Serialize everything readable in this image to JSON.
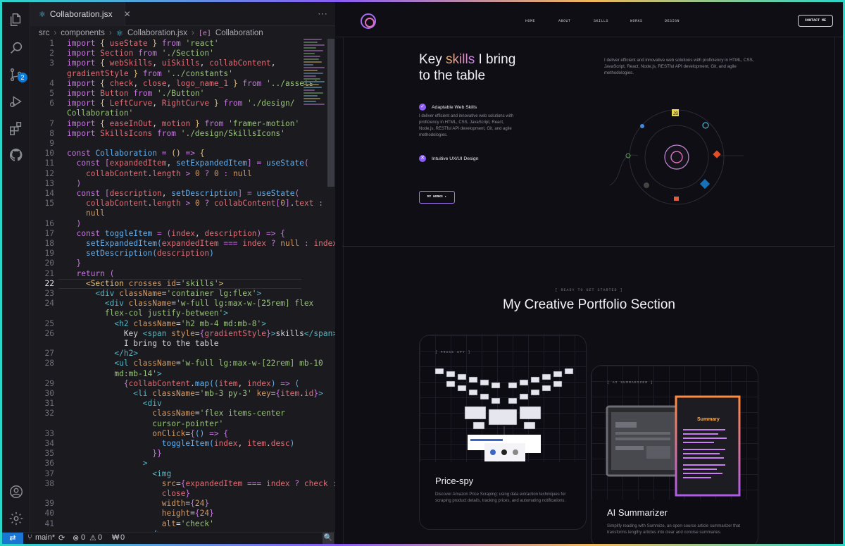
{
  "editor": {
    "tab_label": "Collaboration.jsx",
    "tab_close": "✕",
    "breadcrumb": {
      "folder1": "src",
      "folder2": "components",
      "file": "Collaboration.jsx",
      "symbol": "Collaboration"
    },
    "current_line": 22,
    "lines": [
      {
        "n": "1",
        "html": "<span class='k'>import</span> <span class='t'>{</span> <span class='r'>useState</span> <span class='t'>}</span> <span class='k'>from</span> <span class='s'>'react'</span>"
      },
      {
        "n": "2",
        "html": "<span class='k'>import</span> <span class='r'>Section</span> <span class='k'>from</span> <span class='s'>'./Section'</span>"
      },
      {
        "n": "3",
        "html": "<span class='k'>import</span> <span class='t'>{</span> <span class='r'>webSkills</span>, <span class='r'>uiSkills</span>, <span class='r'>collabContent</span>,"
      },
      {
        "n": "",
        "html": "<span class='r'>gradientStyle</span> <span class='t'>}</span> <span class='k'>from</span> <span class='s'>'../constants'</span>"
      },
      {
        "n": "4",
        "html": "<span class='k'>import</span> <span class='t'>{</span> <span class='r'>check</span>, <span class='r'>close</span>, <span class='r'>logo_name_1</span> <span class='t'>}</span> <span class='k'>from</span> <span class='s'>'../assets'</span>"
      },
      {
        "n": "5",
        "html": "<span class='k'>import</span> <span class='r'>Button</span> <span class='k'>from</span> <span class='s'>'./Button'</span>"
      },
      {
        "n": "6",
        "html": "<span class='k'>import</span> <span class='t'>{</span> <span class='r'>LeftCurve</span>, <span class='r'>RightCurve</span> <span class='t'>}</span> <span class='k'>from</span> <span class='s'>'./design/</span>"
      },
      {
        "n": "",
        "html": "<span class='s'>Collaboration'</span>"
      },
      {
        "n": "7",
        "html": "<span class='k'>import</span> <span class='t'>{</span> <span class='r'>easeInOut</span>, <span class='r'>motion</span> <span class='t'>}</span> <span class='k'>from</span> <span class='s'>'framer-motion'</span>"
      },
      {
        "n": "8",
        "html": "<span class='k'>import</span> <span class='r'>SkillsIcons</span> <span class='k'>from</span> <span class='s'>'./design/SkillsIcons'</span>"
      },
      {
        "n": "9",
        "html": ""
      },
      {
        "n": "10",
        "html": "<span class='k'>const</span> <span class='v'>Collaboration</span> <span class='k'>=</span> <span class='t'>()</span> <span class='k'>=&gt;</span> <span class='t'>{</span>"
      },
      {
        "n": "11",
        "html": "  <span class='k'>const</span> <span class='k'>[</span><span class='r'>expandedItem</span>, <span class='v'>setExpandedItem</span><span class='k'>]</span> <span class='k'>=</span> <span class='v'>useState</span><span class='k'>(</span>"
      },
      {
        "n": "12",
        "html": "    <span class='r'>collabContent</span>.<span class='r'>length</span> <span class='k'>&gt;</span> <span class='a'>0</span> <span class='k'>?</span> <span class='a'>0</span> <span class='k'>:</span> <span class='a'>null</span>"
      },
      {
        "n": "13",
        "html": "  <span class='k'>)</span>"
      },
      {
        "n": "14",
        "html": "  <span class='k'>const</span> <span class='k'>[</span><span class='r'>description</span>, <span class='v'>setDescription</span><span class='k'>]</span> <span class='k'>=</span> <span class='v'>useState</span><span class='k'>(</span>"
      },
      {
        "n": "15",
        "html": "    <span class='r'>collabContent</span>.<span class='r'>length</span> <span class='k'>&gt;</span> <span class='a'>0</span> <span class='k'>?</span> <span class='r'>collabContent</span><span class='k'>[</span><span class='a'>0</span><span class='k'>]</span>.<span class='r'>text</span> <span class='k'>:</span>"
      },
      {
        "n": "",
        "html": "    <span class='a'>null</span>"
      },
      {
        "n": "16",
        "html": "  <span class='k'>)</span>"
      },
      {
        "n": "17",
        "html": "  <span class='k'>const</span> <span class='v'>toggleItem</span> <span class='k'>=</span> <span class='k'>(</span><span class='r'>index</span>, <span class='r'>description</span><span class='k'>)</span> <span class='k'>=&gt;</span> <span class='k'>{</span>"
      },
      {
        "n": "18",
        "html": "    <span class='v'>setExpandedItem</span><span class='v'>(</span><span class='r'>expandedItem</span> <span class='k'>===</span> <span class='r'>index</span> <span class='k'>?</span> <span class='a'>null</span> <span class='k'>:</span> <span class='r'>index</span><span class='v'>)</span>"
      },
      {
        "n": "19",
        "html": "    <span class='v'>setDescription</span><span class='v'>(</span><span class='r'>description</span><span class='v'>)</span>"
      },
      {
        "n": "20",
        "html": "  <span class='k'>}</span>"
      },
      {
        "n": "21",
        "html": "  <span class='k'>return</span> <span class='k'>(</span>"
      },
      {
        "n": "22",
        "html": "    <span class='y'>&lt;Section</span> <span class='a'>crosses</span> <span class='a'>id</span>=<span class='s'>'skills'</span><span class='y'>&gt;</span>"
      },
      {
        "n": "23",
        "html": "      <span class='g'>&lt;div</span> <span class='a'>className</span>=<span class='s'>'container lg:flex'</span><span class='g'>&gt;</span>"
      },
      {
        "n": "24",
        "html": "        <span class='g'>&lt;div</span> <span class='a'>className</span>=<span class='s'>'w-full lg:max-w-[25rem] flex</span>"
      },
      {
        "n": "",
        "html": "        <span class='s'>flex-col justify-between'</span><span class='g'>&gt;</span>"
      },
      {
        "n": "25",
        "html": "          <span class='g'>&lt;h2</span> <span class='a'>className</span>=<span class='s'>'h2 mb-4 md:mb-8'</span><span class='g'>&gt;</span>"
      },
      {
        "n": "26",
        "html": "            Key <span class='g'>&lt;span</span> <span class='a'>style</span>=<span class='k'>{</span><span class='r'>gradientStyle</span><span class='k'>}</span><span class='g'>&gt;</span>skills<span class='g'>&lt;/span&gt;</span>"
      },
      {
        "n": "",
        "html": "            I bring to the table"
      },
      {
        "n": "27",
        "html": "          <span class='g'>&lt;/h2&gt;</span>"
      },
      {
        "n": "28",
        "html": "          <span class='g'>&lt;ul</span> <span class='a'>className</span>=<span class='s'>'w-full lg:max-w-[22rem] mb-10</span>"
      },
      {
        "n": "",
        "html": "          <span class='s'>md:mb-14'</span><span class='g'>&gt;</span>"
      },
      {
        "n": "29",
        "html": "            <span class='k'>{</span><span class='r'>collabContent</span>.<span class='v'>map</span><span class='v'>((</span><span class='r'>item</span>, <span class='r'>index</span><span class='v'>)</span> <span class='k'>=&gt;</span> <span class='v'>(</span>"
      },
      {
        "n": "30",
        "html": "              <span class='g'>&lt;li</span> <span class='a'>className</span>=<span class='s'>'mb-3 py-3'</span> <span class='a'>key</span>=<span class='k'>{</span><span class='r'>item</span>.<span class='r'>id</span><span class='k'>}</span><span class='g'>&gt;</span>"
      },
      {
        "n": "31",
        "html": "                <span class='g'>&lt;div</span>"
      },
      {
        "n": "32",
        "html": "                  <span class='a'>className</span>=<span class='s'>'flex items-center</span>"
      },
      {
        "n": "",
        "html": "                  <span class='s'>cursor-pointer'</span>"
      },
      {
        "n": "33",
        "html": "                  <span class='a'>onClick</span>=<span class='k'>{</span><span class='v'>()</span> <span class='k'>=&gt;</span> <span class='k'>{</span>"
      },
      {
        "n": "34",
        "html": "                    <span class='v'>toggleItem</span><span class='v'>(</span><span class='r'>index</span>, <span class='r'>item</span>.<span class='r'>desc</span><span class='v'>)</span>"
      },
      {
        "n": "35",
        "html": "                  <span class='k'>}}</span>"
      },
      {
        "n": "36",
        "html": "                <span class='g'>&gt;</span>"
      },
      {
        "n": "37",
        "html": "                  <span class='g'>&lt;img</span>"
      },
      {
        "n": "38",
        "html": "                    <span class='a'>src</span>=<span class='k'>{</span><span class='r'>expandedItem</span> <span class='k'>===</span> <span class='r'>index</span> <span class='k'>?</span> <span class='r'>check</span> <span class='k'>:</span>"
      },
      {
        "n": "",
        "html": "                    <span class='r'>close</span><span class='k'>}</span>"
      },
      {
        "n": "39",
        "html": "                    <span class='a'>width</span>=<span class='k'>{</span><span class='a'>24</span><span class='k'>}</span>"
      },
      {
        "n": "40",
        "html": "                    <span class='a'>height</span>=<span class='k'>{</span><span class='a'>24</span><span class='k'>}</span>"
      },
      {
        "n": "41",
        "html": "                    <span class='a'>alt</span>=<span class='s'>'check'</span>"
      },
      {
        "n": "",
        "html": "                  <span class='g'>/&gt;</span>"
      }
    ]
  },
  "status": {
    "branch": "main*",
    "errors": "0",
    "warnings": "0",
    "ports": "0",
    "scm_badge": "2"
  },
  "site": {
    "nav": [
      "HOME",
      "ABOUT",
      "SKILLS",
      "WORKS",
      "DESIGN"
    ],
    "contact": "CONTACT ME",
    "skills_title_a": "Key",
    "skills_title_b": "skills",
    "skills_title_c": "I bring",
    "skills_title_d": "to the table",
    "skills_desc": "I deliver efficient and innovative web solutions with proficiency in HTML, CSS, JavaScript, React, Node.js, RESTful API development, Git, and agile methodologies.",
    "feature1": "Adaptable Web Skills",
    "feature1_desc": "I deliver efficient and innovative web solutions with proficiency in HTML, CSS, JavaScript, React, Node.js, RESTful API development, Git, and agile methodologies.",
    "feature2": "Intuitive UX/UI Design",
    "my_works": "MY WORKS ▸",
    "eyebrow": "[ READY TO GET STARTED ]",
    "portfolio_title": "My Creative Portfolio Section",
    "card1": {
      "tag": "[ PRICE SPY ]",
      "name": "Price-spy",
      "desc": "Discover Amazon Price Scraping: using data extraction techniques for scraping product details, tracking prices, and automating notifications."
    },
    "card2": {
      "tag": "[ AI SUMMARIZER ]",
      "name": "AI Summarizer",
      "desc": "Simplify reading with Summize, an open-source article summarizer that transforms lengthy articles into clear and concise summaries.",
      "screen_label": "Summary"
    }
  }
}
